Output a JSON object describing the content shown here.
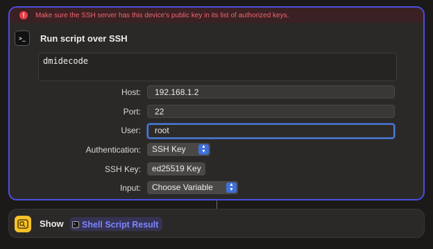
{
  "error": {
    "icon": "exclamation-icon",
    "icon_glyph": "!",
    "message": "Make sure the SSH server has this device's public key in its list of authorized keys."
  },
  "action": {
    "icon": "terminal-icon",
    "icon_glyph": ">_",
    "title": "Run script over SSH",
    "script": "dmidecode",
    "fields": {
      "host_label": "Host:",
      "host_value": "192.168.1.2",
      "port_label": "Port:",
      "port_value": "22",
      "user_label": "User:",
      "user_value": "root",
      "auth_label": "Authentication:",
      "auth_value": "SSH Key",
      "sshkey_label": "SSH Key:",
      "sshkey_value": "ed25519 Key",
      "input_label": "Input:",
      "input_value": "Choose Variable"
    }
  },
  "show_action": {
    "icon": "show-result-icon",
    "label": "Show",
    "variable_icon": "terminal-icon",
    "variable": "Shell Script Result"
  },
  "colors": {
    "accent": "#4d4ee0",
    "error": "#f0676f",
    "variable": "#7d86ff",
    "show_icon": "#f5c229"
  }
}
